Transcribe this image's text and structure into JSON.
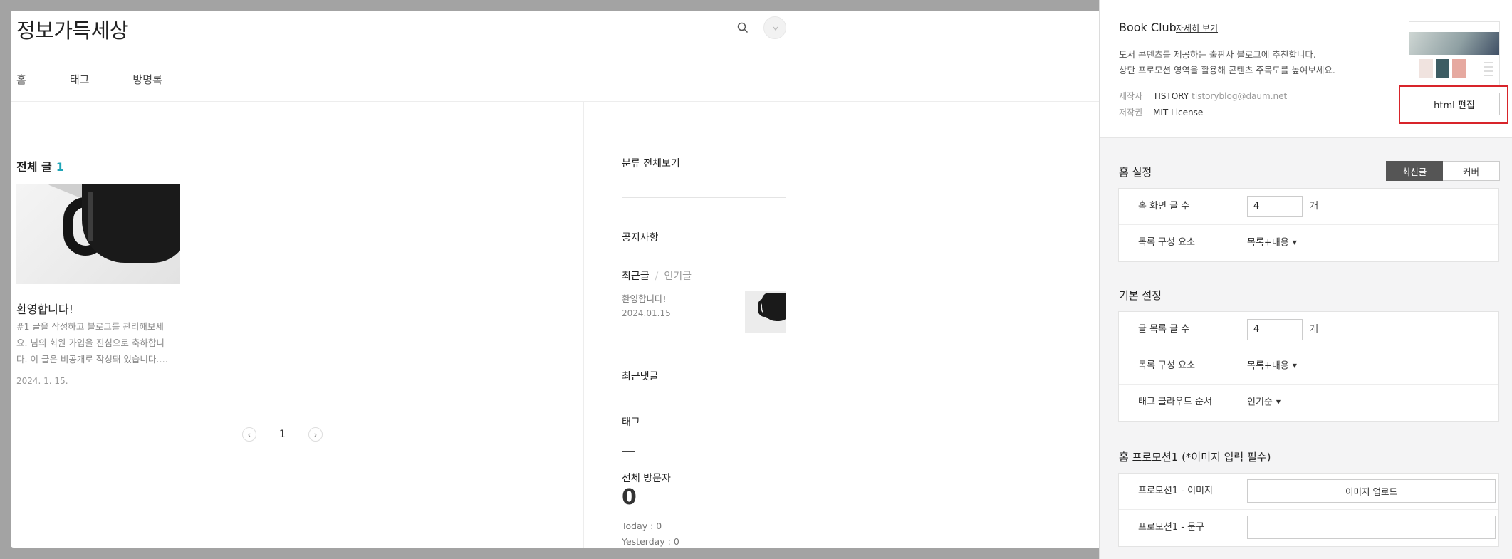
{
  "preview": {
    "blog_title": "정보가득세상",
    "nav": [
      "홈",
      "태그",
      "방명록"
    ],
    "all_posts_label": "전체 글",
    "all_posts_count": "1",
    "post": {
      "title": "환영합니다!",
      "excerpt": "#1 글을 작성하고 블로그를 관리해보세요. 님의 회원 가입을 진심으로 축하합니다. 이 글은 비공개로 작성돼 있습니다.…",
      "date": "2024. 1. 15."
    },
    "pagination": {
      "prev": "‹",
      "current": "1",
      "next": "›"
    },
    "sidebar": {
      "category_all": "분류 전체보기",
      "notice": "공지사항",
      "tab_recent": "최근글",
      "tab_popular": "인기글",
      "recent_post_title": "환영합니다!",
      "recent_post_date": "2024.01.15",
      "recent_comments": "최근댓글",
      "tag": "태그",
      "total_visitors_label": "전체 방문자",
      "total_visitors_value": "0",
      "today": "Today : 0",
      "yesterday": "Yesterday : 0"
    }
  },
  "settings": {
    "skin": {
      "name": "Book Club",
      "more_link": "자세히 보기",
      "desc_line1": "도서 콘텐츠를 제공하는 출판사 블로그에 추천합니다.",
      "desc_line2": "상단 프로모션 영역을 활용해 콘텐츠 주목도를 높여보세요.",
      "maker_label": "제작자",
      "maker_value": "TISTORY",
      "maker_email": "tistoryblog@daum.net",
      "license_label": "저작권",
      "license_value": "MIT License",
      "html_edit_button": "html 편집"
    },
    "home": {
      "title": "홈 설정",
      "toggle_latest": "최신글",
      "toggle_cover": "커버",
      "home_count_label": "홈 화면 글 수",
      "home_count_value": "4",
      "unit": "개",
      "list_elem_label": "목록 구성 요소",
      "list_elem_value": "목록+내용"
    },
    "basic": {
      "title": "기본 설정",
      "post_count_label": "글 목록 글 수",
      "post_count_value": "4",
      "unit": "개",
      "list_elem_label": "목록 구성 요소",
      "list_elem_value": "목록+내용",
      "tag_order_label": "태그 클라우드 순서",
      "tag_order_value": "인기순"
    },
    "promo": {
      "title": "홈 프로모션1 (*이미지 입력 필수)",
      "image_label": "프로모션1 - 이미지",
      "upload_button": "이미지 업로드",
      "text_label": "프로모션1 - 문구",
      "text_value": ""
    }
  },
  "colors": {
    "accent": "#1fa5b7",
    "highlight": "#d8242a",
    "toggle_active": "#555555"
  }
}
